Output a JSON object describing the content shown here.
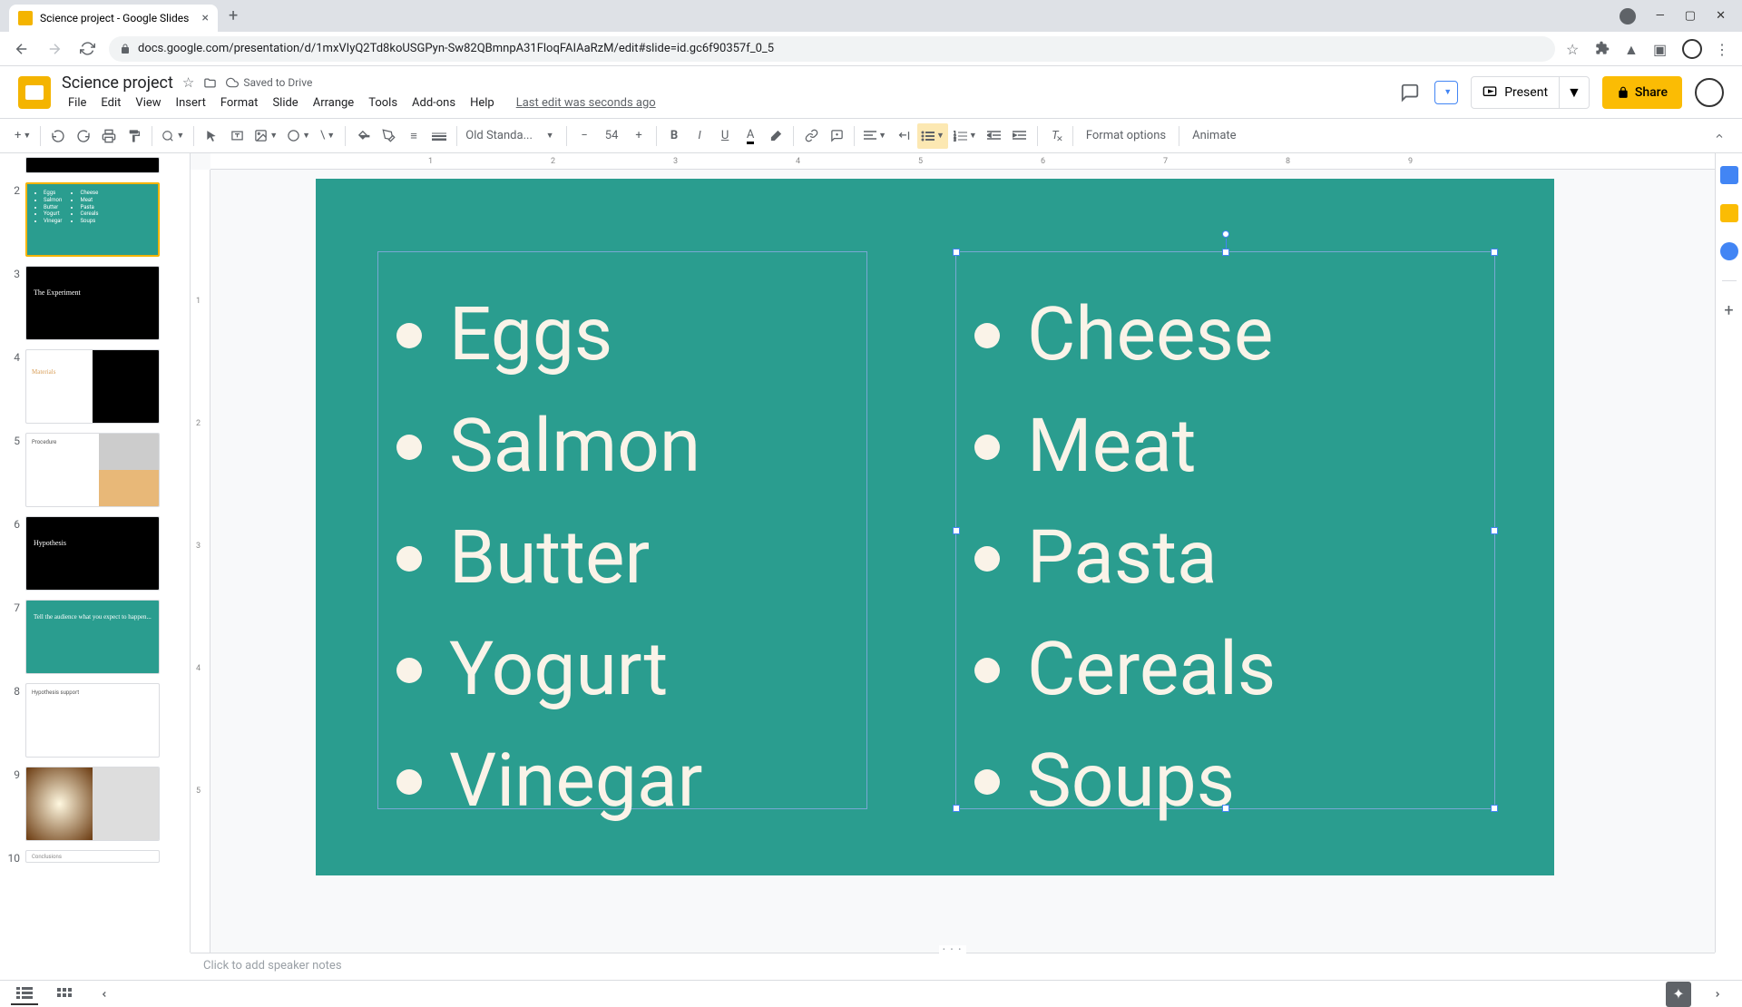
{
  "browser": {
    "tab_title": "Science project - Google Slides",
    "url": "docs.google.com/presentation/d/1mxVIyQ2Td8koUSGPyn-Sw82QBmnpA31FloqFAIAaRzM/edit#slide=id.gc6f90357f_0_5"
  },
  "docs": {
    "title": "Science project",
    "saved": "Saved to Drive",
    "last_edit": "Last edit was seconds ago",
    "menus": [
      "File",
      "Edit",
      "View",
      "Insert",
      "Format",
      "Slide",
      "Arrange",
      "Tools",
      "Add-ons",
      "Help"
    ],
    "present": "Present",
    "share": "Share"
  },
  "toolbar": {
    "font": "Old Standa...",
    "font_size": "54",
    "format_options": "Format options",
    "animate": "Animate"
  },
  "slide": {
    "left_items": [
      "Eggs",
      "Salmon",
      "Butter",
      "Yogurt",
      "Vinegar"
    ],
    "right_items": [
      "Cheese",
      "Meat",
      "Pasta",
      "Cereals",
      "Soups"
    ]
  },
  "thumbs": {
    "t2_left": [
      "Eggs",
      "Salmon",
      "Butter",
      "Yogurt",
      "Vinegar"
    ],
    "t2_right": [
      "Cheese",
      "Meat",
      "Pasta",
      "Cereals",
      "Soups"
    ],
    "t3": "The Experiment",
    "t4": "Materials",
    "t5": "Procedure",
    "t6": "Hypothesis",
    "t7": "Tell the audience what you expect to happen...",
    "t8": "Hypothesis support",
    "t10": "Conclusions"
  },
  "notes": {
    "placeholder": "Click to add speaker notes"
  },
  "ruler_h": [
    "1",
    "2",
    "3",
    "4",
    "5",
    "6",
    "7",
    "8",
    "9"
  ],
  "ruler_v": [
    "1",
    "2",
    "3",
    "4",
    "5"
  ]
}
